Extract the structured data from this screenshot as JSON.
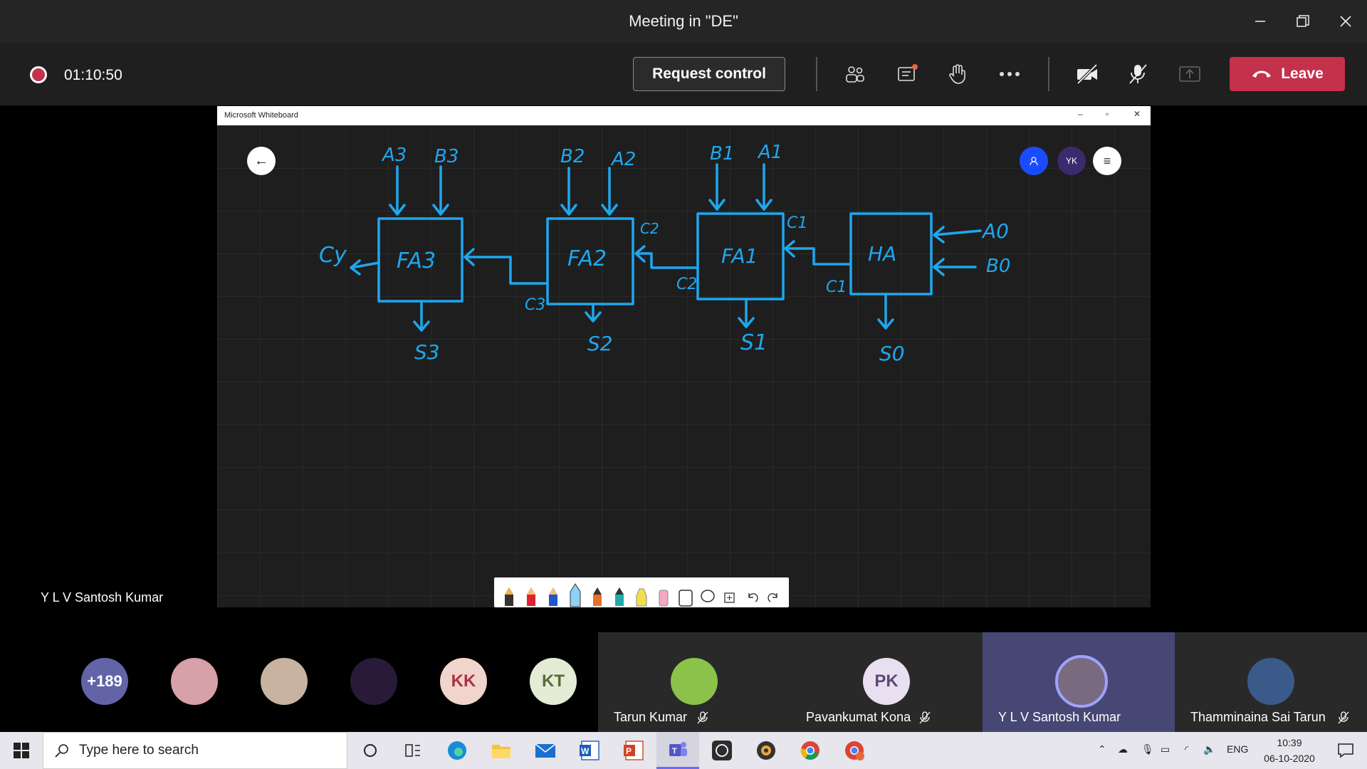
{
  "window": {
    "title": "Meeting in \"DE\""
  },
  "toolbar": {
    "timer": "01:10:50",
    "request_control": "Request control",
    "leave": "Leave"
  },
  "whiteboard": {
    "app_title": "Microsoft Whiteboard",
    "user_initials": "YK",
    "labels": {
      "a3": "A3",
      "b3": "B3",
      "b2": "B2",
      "a2": "A2",
      "b1": "B1",
      "a1": "A1",
      "cy": "Cy",
      "fa3": "FA3",
      "fa2": "FA2",
      "fa1": "FA1",
      "ha": "HA",
      "c2_top": "C2",
      "c2_bottom": "C2",
      "c1_top": "C1",
      "c1_bottom": "C1",
      "c3": "C3",
      "a0": "A0",
      "b0": "B0",
      "s3": "S3",
      "s2": "S2",
      "s1": "S1",
      "s0": "S0"
    }
  },
  "presenter": "Y L V Santosh Kumar",
  "participants": {
    "overflow_count": "+189",
    "avatars": [
      {
        "initials": "",
        "color": "#d8a0a8"
      },
      {
        "initials": "",
        "color": "#c8b2a0"
      },
      {
        "initials": "",
        "color": "#2a1a3a"
      },
      {
        "initials": "KK",
        "color": "#f0d5cc"
      },
      {
        "initials": "KT",
        "color": "#e4ecd6"
      }
    ],
    "tiles": [
      {
        "name": "Tarun Kumar",
        "initials": ""
      },
      {
        "name": "Pavankumat Kona",
        "initials": "PK"
      },
      {
        "name": "Y L V Santosh Kumar",
        "initials": ""
      },
      {
        "name": "Thamminaina Sai Tarun",
        "initials": ""
      }
    ]
  },
  "taskbar": {
    "search_placeholder": "Type here to search",
    "lang": "ENG",
    "time": "10:39",
    "date": "06-10-2020"
  },
  "colors": {
    "leave": "#c4314b",
    "ink": "#1ea7ee",
    "accent": "#6264a7"
  }
}
